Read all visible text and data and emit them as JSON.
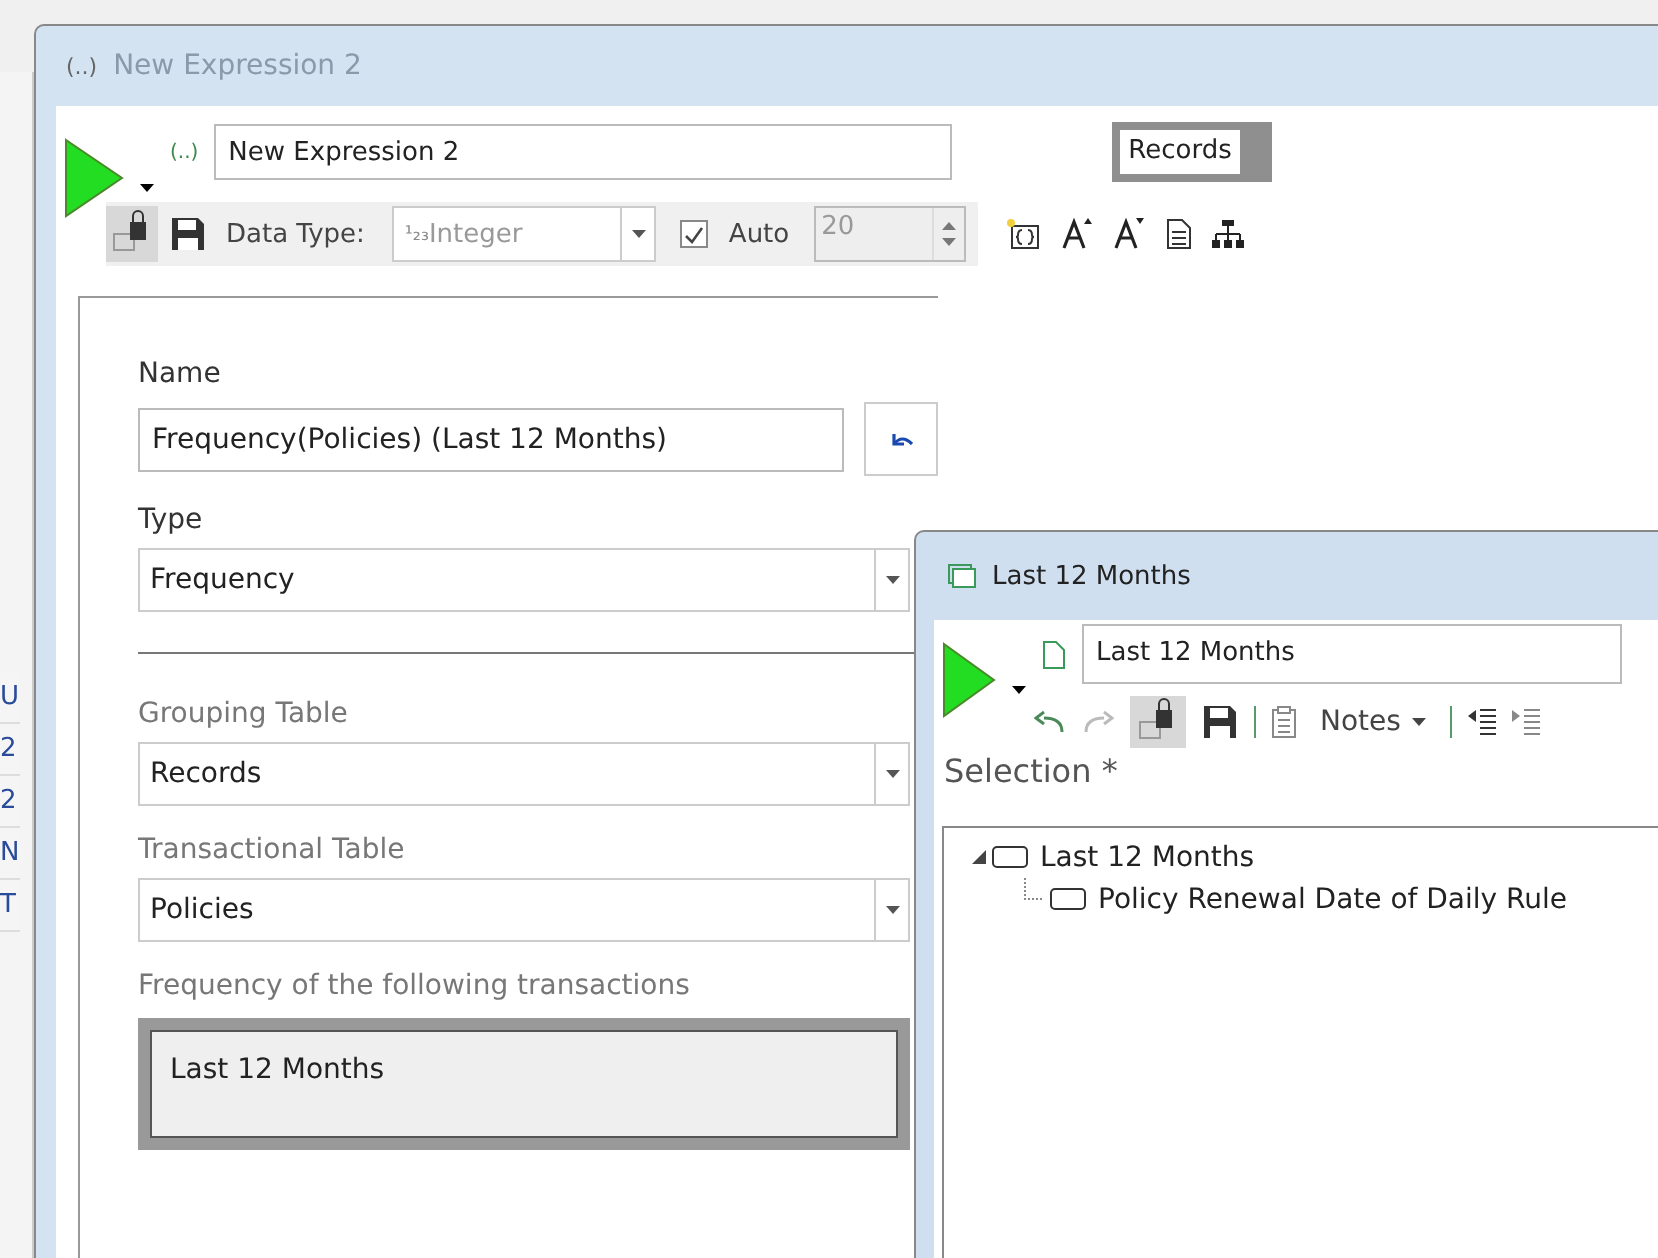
{
  "background_window": {
    "row_fragments": [
      "U",
      "2",
      "2",
      "N",
      "T"
    ]
  },
  "window": {
    "title": "New Expression 2",
    "icon_text": "(..)",
    "header": {
      "name_icon": "(..)",
      "name_value": "New Expression 2",
      "table_chip": "Records"
    },
    "toolbar": {
      "data_type_label": "Data Type:",
      "data_type_value": "Integer",
      "data_type_glyph": "¹₂₃",
      "auto": {
        "label": "Auto",
        "checked": true
      },
      "size_value": "20"
    },
    "form": {
      "name_label": "Name",
      "name_value": "Frequency(Policies) (Last 12 Months)",
      "type_label": "Type",
      "type_value": "Frequency",
      "grouping_label": "Grouping Table",
      "grouping_value": "Records",
      "transactional_label": "Transactional Table",
      "transactional_value": "Policies",
      "frequency_label": "Frequency of the following transactions",
      "frequency_value": "Last 12 Months"
    }
  },
  "sub_window": {
    "title": "Last 12 Months",
    "name_value": "Last 12 Months",
    "notes_label": "Notes",
    "section_title": "Selection *",
    "tree": [
      {
        "label": "Last 12 Months",
        "expanded": true,
        "children": [
          {
            "label": "Policy Renewal Date of Daily Rule"
          }
        ]
      }
    ]
  }
}
